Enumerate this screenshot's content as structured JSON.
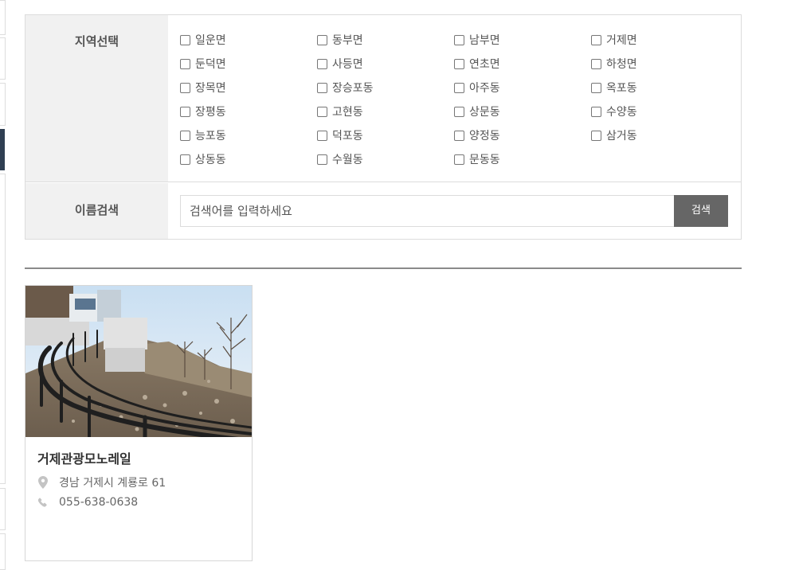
{
  "filter": {
    "region_label": "지역선택",
    "regions": [
      "일운면",
      "동부면",
      "남부면",
      "거제면",
      "둔덕면",
      "사등면",
      "연초면",
      "하청면",
      "장목면",
      "장승포동",
      "아주동",
      "옥포동",
      "장평동",
      "고현동",
      "상문동",
      "수양동",
      "능포동",
      "덕포동",
      "양정동",
      "삼거동",
      "상동동",
      "수월동",
      "문동동"
    ],
    "search_label": "이름검색",
    "search_placeholder": "검색어를 입력하세요",
    "search_button": "검색"
  },
  "results": [
    {
      "title": "거제관광모노레일",
      "address": "경남 거제시 계룡로 61",
      "phone": "055-638-0638",
      "address_icon": "map-pin-icon",
      "phone_icon": "phone-icon"
    }
  ],
  "colors": {
    "label_bg": "#f1f1f1",
    "button_bg": "#666666",
    "border": "#dcdcdc",
    "active_tab": "#2f3f52"
  }
}
